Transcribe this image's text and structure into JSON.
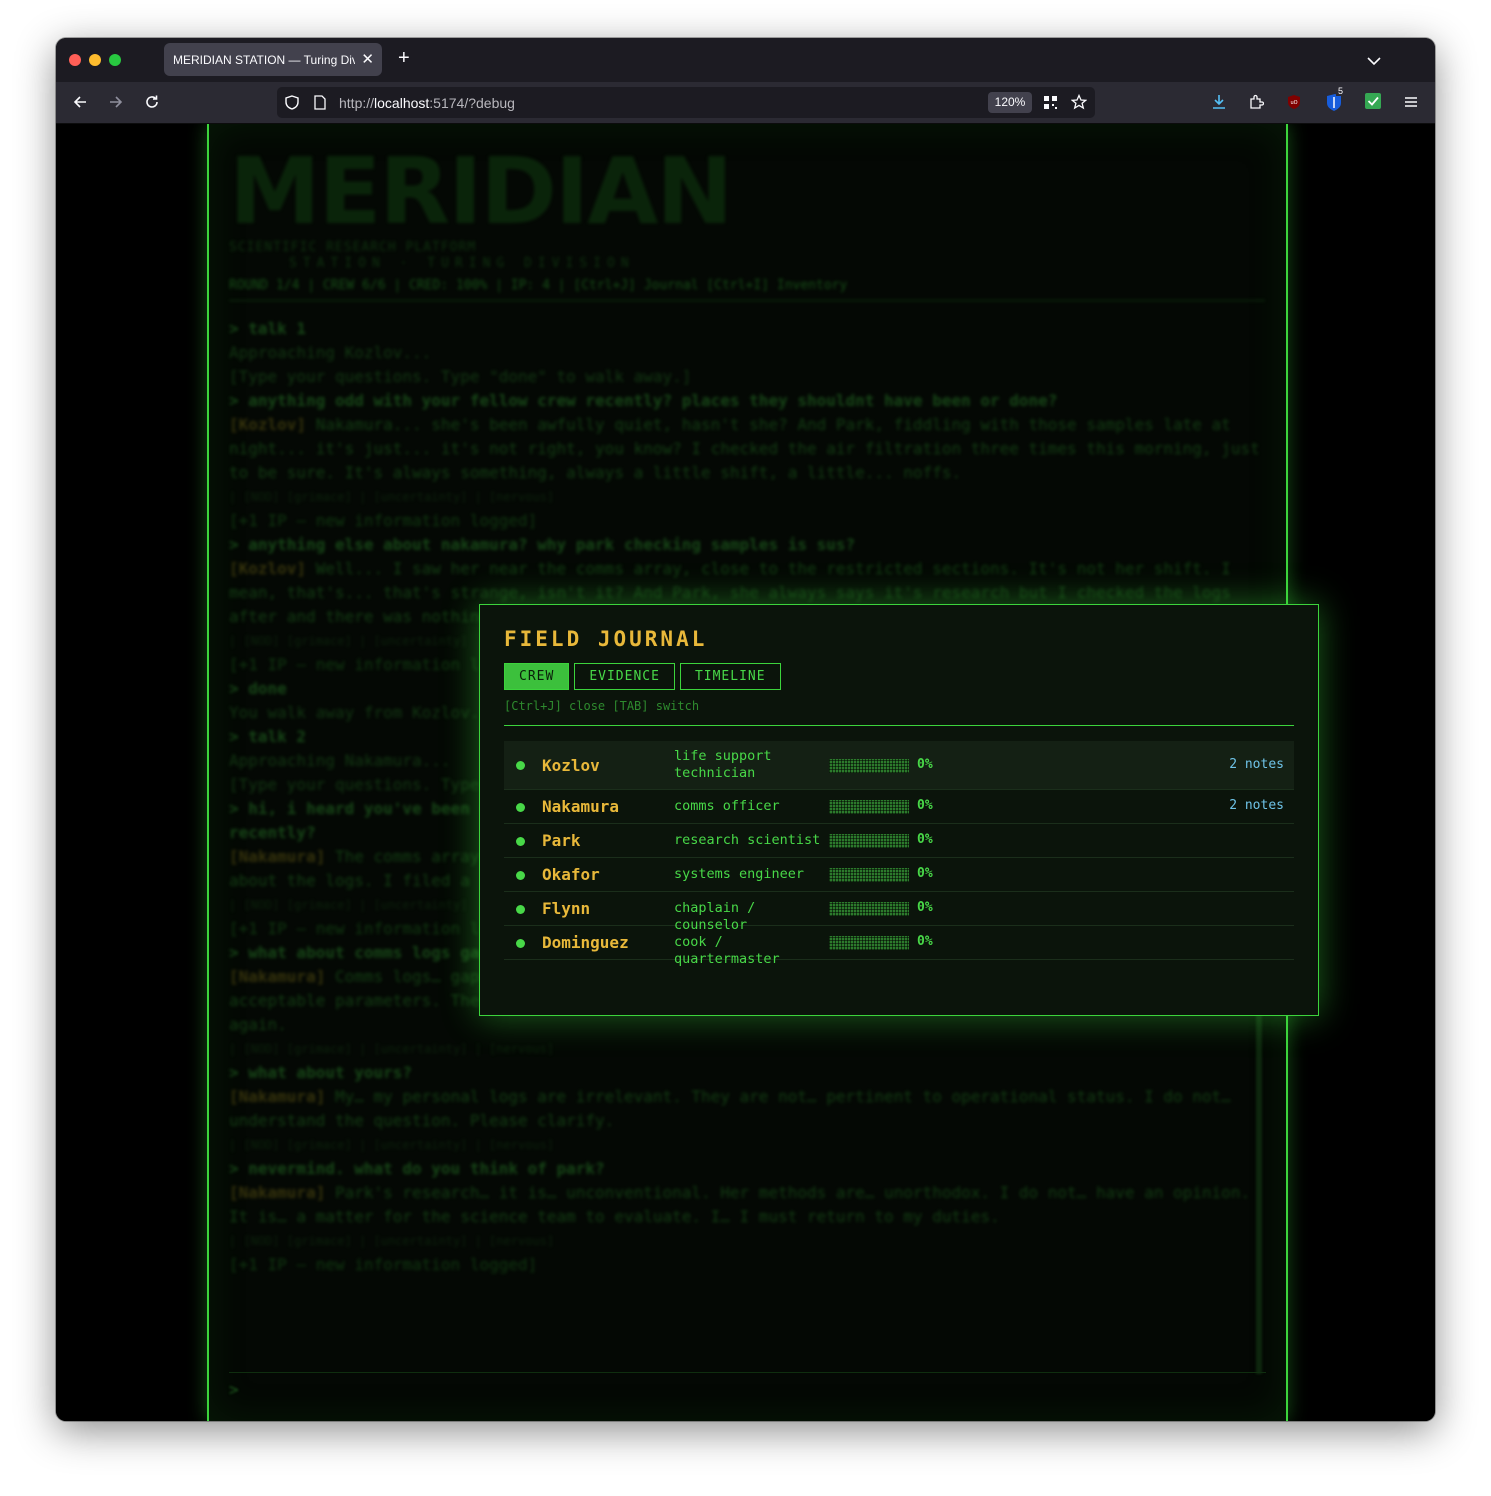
{
  "browser": {
    "tab_title": "MERIDIAN STATION — Turing Division",
    "url_scheme": "http://",
    "url_host": "localhost",
    "url_rest": ":5174/?debug",
    "zoom": "120%",
    "extension_badge": "5",
    "icons": [
      "back-icon",
      "forward-icon",
      "reload-icon",
      "shield-icon",
      "page-icon",
      "qr-icon",
      "star-icon",
      "download-icon",
      "extension-icon",
      "ublock-icon",
      "bitwarden-icon",
      "check-icon",
      "menu-icon"
    ]
  },
  "background": {
    "logo": "MERIDIAN",
    "logo_sub": "SCIENTIFIC RESEARCH PLATFORM",
    "logo_sub2": "STATION · TURING DIVISION",
    "status": "ROUND 1/4 | CREW 6/6 | CRED: 100% | IP: 4 | [Ctrl+J] Journal [Ctrl+I] Inventory",
    "lines": [
      {
        "kind": "cmd",
        "text": "> talk 1"
      },
      {
        "kind": "sys",
        "text": "Approaching Kozlov..."
      },
      {
        "kind": "sys",
        "text": "[Type your questions. Type \"done\" to walk away.]"
      },
      {
        "kind": "cmd",
        "text": "> anything odd with your fellow crew recently? places they shouldnt have been or done?"
      },
      {
        "kind": "speech",
        "speaker": "[Kozlov]",
        "text": " Nakamura... she's been awfully quiet, hasn't she? And Park, fiddling with those samples late at night... it's just... it's not right, you know? I checked the air filtration three times this morning, just to be sure. It's always something, always a little shift, a little... noffs."
      },
      {
        "kind": "meta",
        "text": "| [NOD] [grimace] | [uncertainty] | [nervous]"
      },
      {
        "kind": "ip",
        "text": "[+1 IP — new information logged]"
      },
      {
        "kind": "cmd",
        "text": "> anything else about nakamura? why park checking samples is sus?"
      },
      {
        "kind": "speech",
        "speaker": "[Kozlov]",
        "text": " Well... I saw her near the comms array, close to the restricted sections. It's not her shift. I mean, that's... that's strange, isn't it? And Park, she always says it's research but I checked the logs after and there was nothing there. I don't know, I'm just telling you. It is."
      },
      {
        "kind": "meta",
        "text": "| [NOD] [grimace] | [uncertainty]"
      },
      {
        "kind": "ip",
        "text": "[+1 IP — new information logged]"
      },
      {
        "kind": "cmd",
        "text": "> done"
      },
      {
        "kind": "sys",
        "text": "You walk away from Kozlov."
      },
      {
        "kind": "cmd",
        "text": "> talk 2"
      },
      {
        "kind": "sys",
        "text": "Approaching Nakamura..."
      },
      {
        "kind": "sys",
        "text": "[Type your questions. Type \"done\" to walk away.]"
      },
      {
        "kind": "cmd",
        "text": "> hi, i heard you've been near the comms array. anything strange about the logs? anything you've noticed recently?"
      },
      {
        "kind": "speech",
        "speaker": "[Nakamura]",
        "text": " The comms array. Yes. I was. Performing routine diagnostics. Standard procedure. Nothing strange about the logs. I filed a report yesterday. It is... all in order."
      },
      {
        "kind": "meta",
        "text": "| [NOD] [grimace] | [uncertainty]"
      },
      {
        "kind": "ip",
        "text": "[+1 IP — new information logged]"
      },
      {
        "kind": "cmd",
        "text": "> what about comms logs gaps"
      },
      {
        "kind": "speech",
        "speaker": "[Nakamura]",
        "text": " Comms logs… gaps? That is… unusual. I… no. I am certain the systems are functioning within acceptable parameters. There may have been… a momentary disruption. Unaccounted for. I will review the logs again."
      },
      {
        "kind": "meta",
        "text": "| [NOD] [grimace] | [uncertainty] | [nervous]"
      },
      {
        "kind": "cmd",
        "text": "> what about yours?"
      },
      {
        "kind": "speech",
        "speaker": "[Nakamura]",
        "text": " My… my personal logs are irrelevant. They are not… pertinent to operational status. I do not… understand the question. Please clarify."
      },
      {
        "kind": "meta",
        "text": "| [NOD] [grimace] | [uncertainty] | [nervous]"
      },
      {
        "kind": "cmd",
        "text": "> nevermind. what do you think of park?"
      },
      {
        "kind": "speech",
        "speaker": "[Nakamura]",
        "text": " Park's research… it is… unconventional. Her methods are… unorthodox. I do not… have an opinion. It is… a matter for the science team to evaluate. I… I must return to my duties."
      },
      {
        "kind": "meta",
        "text": "| [NOD] [grimace] | [uncertainty] | [nervous]"
      },
      {
        "kind": "ip",
        "text": "[+1 IP — new information logged]"
      }
    ],
    "prompt": ">"
  },
  "journal": {
    "title": "FIELD JOURNAL",
    "tabs": [
      "CREW",
      "EVIDENCE",
      "TIMELINE"
    ],
    "active_tab": "CREW",
    "hint": "[Ctrl+J] close [TAB] switch",
    "crew": [
      {
        "name": "Kozlov",
        "role": "life support technician",
        "progress": 0,
        "progress_label": "0%",
        "notes": "2 notes",
        "selected": true
      },
      {
        "name": "Nakamura",
        "role": "comms officer",
        "progress": 0,
        "progress_label": "0%",
        "notes": "2 notes"
      },
      {
        "name": "Park",
        "role": "research scientist",
        "progress": 0,
        "progress_label": "0%",
        "notes": ""
      },
      {
        "name": "Okafor",
        "role": "systems engineer",
        "progress": 0,
        "progress_label": "0%",
        "notes": ""
      },
      {
        "name": "Flynn",
        "role": "chaplain / counselor",
        "progress": 0,
        "progress_label": "0%",
        "notes": ""
      },
      {
        "name": "Dominguez",
        "role": "cook / quartermaster",
        "progress": 0,
        "progress_label": "0%",
        "notes": ""
      }
    ],
    "colors": {
      "accent": "#3cd43c",
      "name": "#e8b83a",
      "notes": "#6fc3e8"
    }
  }
}
